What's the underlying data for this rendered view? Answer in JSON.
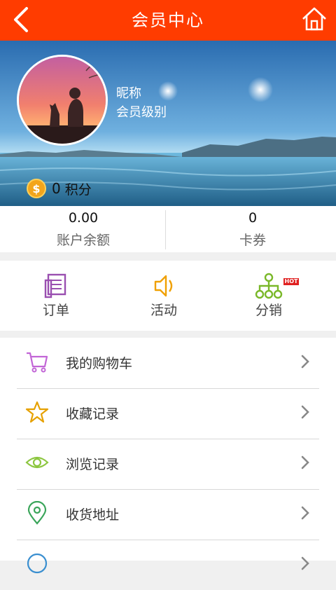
{
  "header": {
    "title": "会员中心",
    "back_icon": "back-arrow-icon",
    "home_icon": "home-icon",
    "color": "#ff3c00"
  },
  "profile": {
    "nickname": "昵称",
    "level": "会员级别",
    "points_value": "0",
    "points_unit": "积分",
    "coin_symbol": "$"
  },
  "stats": [
    {
      "value": "0.00",
      "label": "账户余额"
    },
    {
      "value": "0",
      "label": "卡券"
    }
  ],
  "shortcuts": [
    {
      "label": "订单",
      "icon": "order-icon"
    },
    {
      "label": "活动",
      "icon": "speaker-icon"
    },
    {
      "label": "分销",
      "icon": "distribution-icon",
      "badge": "HOT"
    }
  ],
  "menu": [
    {
      "label": "我的购物车",
      "icon": "cart-icon"
    },
    {
      "label": "收藏记录",
      "icon": "star-icon"
    },
    {
      "label": "浏览记录",
      "icon": "eye-icon"
    },
    {
      "label": "收货地址",
      "icon": "location-pin-icon"
    },
    {
      "label": "",
      "icon": "info-icon"
    }
  ]
}
